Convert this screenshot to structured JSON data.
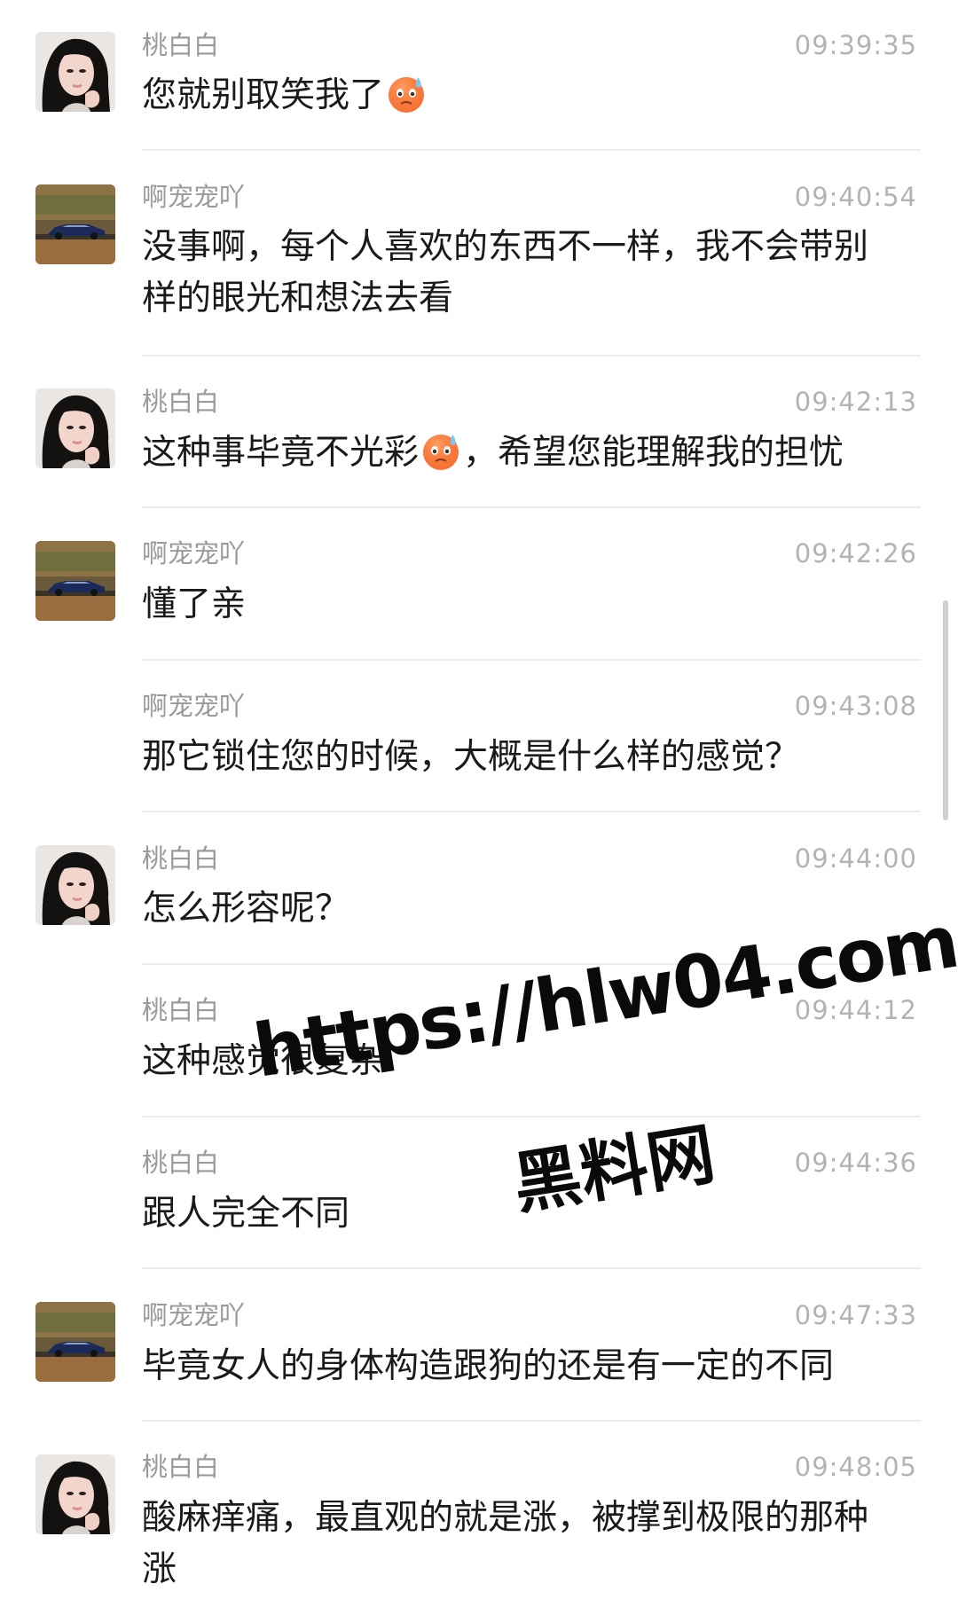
{
  "messages": [
    {
      "sender": "桃白白",
      "time": "09:39:35",
      "avatar": "female-portrait-icon",
      "text_before": "您就别取笑我了",
      "emoji": "cold-sweat-emoji",
      "text_after": ""
    },
    {
      "sender": "啊宠宠吖",
      "time": "09:40:54",
      "avatar": "blue-car-icon",
      "text_line1": "没事啊，每个人喜欢的东西不一样，我不会带别",
      "text_line2": "样的眼光和想法去看"
    },
    {
      "sender": "桃白白",
      "time": "09:42:13",
      "avatar": "female-portrait-icon",
      "text_before": "这种事毕竟不光彩",
      "emoji": "cold-sweat-emoji",
      "text_after": "，希望您能理解我的担忧"
    },
    {
      "sender": "啊宠宠吖",
      "time": "09:42:26",
      "avatar": "blue-car-icon",
      "text": "懂了亲"
    },
    {
      "sender": "啊宠宠吖",
      "time": "09:43:08",
      "text": "那它锁住您的时候，大概是什么样的感觉？"
    },
    {
      "sender": "桃白白",
      "time": "09:44:00",
      "avatar": "female-portrait-icon",
      "text": "怎么形容呢？"
    },
    {
      "sender": "桃白白",
      "time": "09:44:12",
      "text": "这种感觉很复杂"
    },
    {
      "sender": "桃白白",
      "time": "09:44:36",
      "text": "跟人完全不同"
    },
    {
      "sender": "啊宠宠吖",
      "time": "09:47:33",
      "avatar": "blue-car-icon",
      "text": "毕竟女人的身体构造跟狗的还是有一定的不同"
    },
    {
      "sender": "桃白白",
      "time": "09:48:05",
      "avatar": "female-portrait-icon",
      "text_line1": "酸麻痒痛，最直观的就是涨，被撑到极限的那种",
      "text_line2": "涨"
    }
  ],
  "watermark": {
    "line1": "https://hlw04.com",
    "line2": "黑料网"
  },
  "colors": {
    "name": "#9a9a9a",
    "time": "#b3b3b3",
    "text": "#1a1a1a",
    "separator": "#ececec"
  }
}
